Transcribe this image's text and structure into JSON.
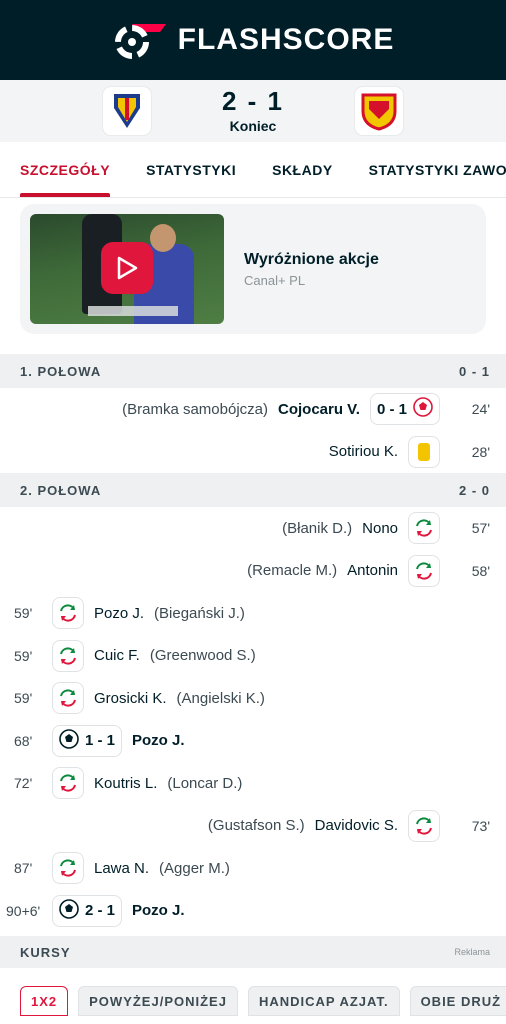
{
  "app": {
    "name": "FLASHSCORE"
  },
  "match": {
    "score": "2 - 1",
    "status": "Koniec"
  },
  "tabs": [
    {
      "label": "SZCZEGÓŁY",
      "active": true
    },
    {
      "label": "STATYSTYKI"
    },
    {
      "label": "SKŁADY"
    },
    {
      "label": "STATYSTYKI ZAWODNI"
    }
  ],
  "highlight": {
    "title": "Wyróżnione akcje",
    "source": "Canal+ PL"
  },
  "first_half": {
    "label": "1. POŁOWA",
    "score": "0 - 1",
    "events": [
      {
        "minute": "24'",
        "note": "(Bramka samobójcza)",
        "player": "Cojocaru V.",
        "score": "0 - 1",
        "icon": "goal-icon"
      },
      {
        "minute": "28'",
        "player": "Sotiriou K.",
        "icon": "yellow-card-icon"
      }
    ]
  },
  "second_half": {
    "label": "2. POŁOWA",
    "score": "2 - 0",
    "events": [
      {
        "side": "away",
        "minute": "57'",
        "assist": "(Błanik D.)",
        "player": "Nono",
        "icon": "substitution-icon"
      },
      {
        "side": "away",
        "minute": "58'",
        "assist": "(Remacle M.)",
        "player": "Antonin",
        "icon": "substitution-icon"
      },
      {
        "side": "home",
        "minute": "59'",
        "player": "Pozo J.",
        "assist": "(Biegański J.)",
        "icon": "substitution-icon"
      },
      {
        "side": "home",
        "minute": "59'",
        "player": "Cuic F.",
        "assist": "(Greenwood S.)",
        "icon": "substitution-icon"
      },
      {
        "side": "home",
        "minute": "59'",
        "player": "Grosicki K.",
        "assist": "(Angielski K.)",
        "icon": "substitution-icon"
      },
      {
        "side": "home",
        "minute": "68'",
        "score": "1 - 1",
        "player": "Pozo J.",
        "icon": "goal-icon"
      },
      {
        "side": "home",
        "minute": "72'",
        "player": "Koutris L.",
        "assist": "(Loncar D.)",
        "icon": "substitution-icon"
      },
      {
        "side": "away",
        "minute": "73'",
        "assist": "(Gustafson S.)",
        "player": "Davidovic S.",
        "icon": "substitution-icon"
      },
      {
        "side": "home",
        "minute": "87'",
        "player": "Lawa N.",
        "assist": "(Agger M.)",
        "icon": "substitution-icon"
      },
      {
        "side": "home",
        "minute": "90+6'",
        "score": "2 - 1",
        "player": "Pozo J.",
        "icon": "goal-icon"
      }
    ]
  },
  "odds": {
    "label": "KURSY",
    "ad_label": "Reklama",
    "tabs": [
      "1X2",
      "POWYŻEJ/PONIŻEJ",
      "HANDICAP AZJAT.",
      "OBIE DRUŻ"
    ]
  },
  "colors": {
    "accent": "#c8102e",
    "header": "#001e28",
    "yellow_card": "#f5c400"
  }
}
